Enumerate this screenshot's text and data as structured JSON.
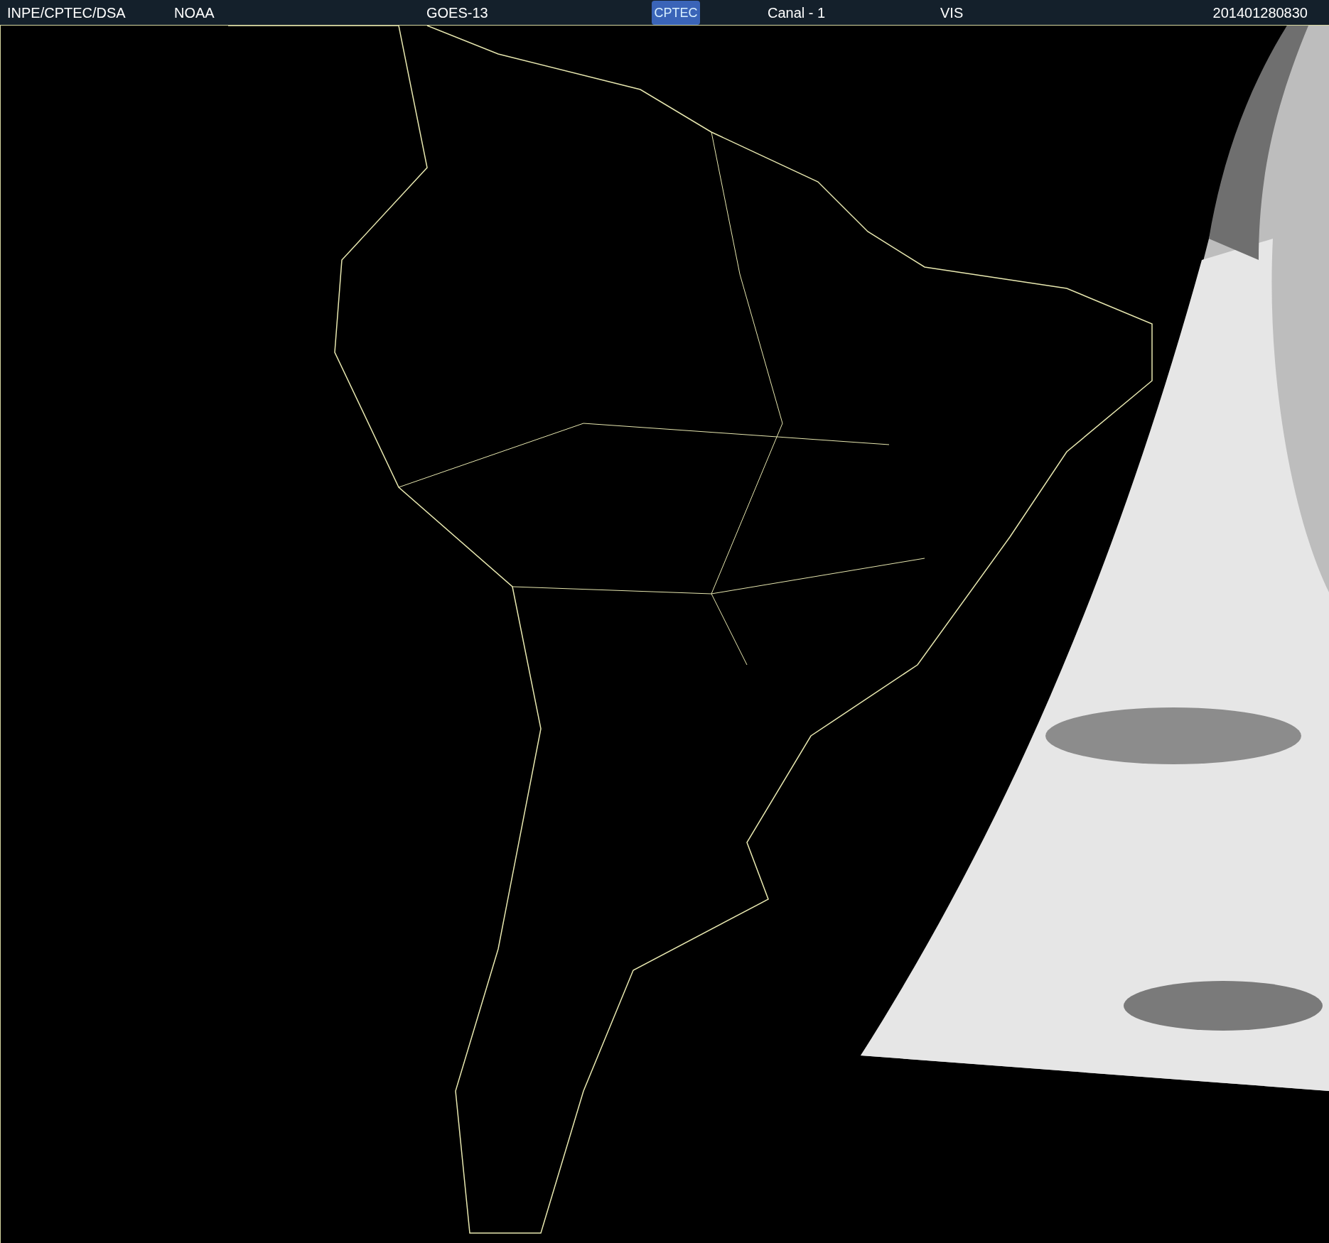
{
  "header": {
    "source": "INPE/CPTEC/DSA",
    "agency": "NOAA",
    "satellite": "GOES-13",
    "logo": "CPTEC",
    "channel": "Canal - 1",
    "band": "VIS",
    "timestamp": "201401280830"
  }
}
